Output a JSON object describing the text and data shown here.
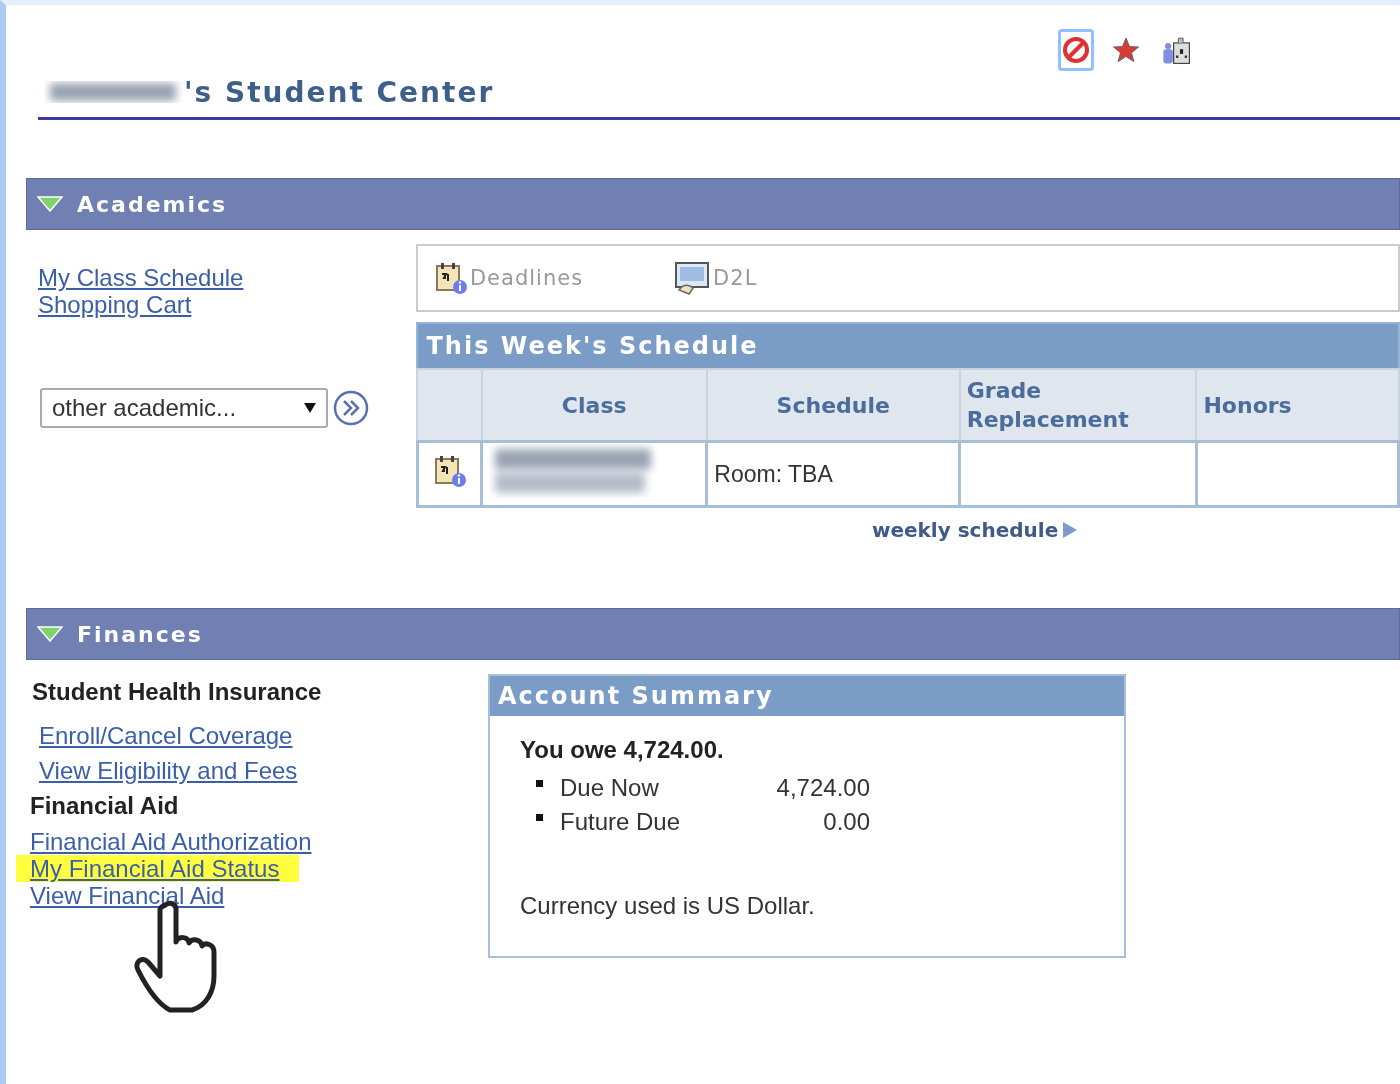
{
  "page_title": "'s Student Center",
  "header_icons": [
    {
      "kind": "no-entry",
      "selected": true
    },
    {
      "kind": "star",
      "selected": false
    },
    {
      "kind": "campus",
      "selected": false
    }
  ],
  "academics": {
    "title": "Academics",
    "expanded": true,
    "links": [
      "My Class Schedule",
      "Shopping Cart"
    ],
    "select": {
      "value": "other academic..."
    },
    "quick_links": [
      {
        "kind": "calendar",
        "label": "Deadlines"
      },
      {
        "kind": "monitor",
        "label": "D2L"
      }
    ],
    "schedule": {
      "title": "This Week's Schedule",
      "columns": [
        "Class",
        "Schedule",
        "Grade Replacement",
        "Honors"
      ],
      "rows": [
        {
          "schedule": "Room:  TBA",
          "grade_replacement": "",
          "honors": ""
        }
      ]
    },
    "weekly_link": "weekly schedule"
  },
  "finances": {
    "title": "Finances",
    "expanded": true,
    "groups": [
      {
        "heading": "Student Health Insurance",
        "indented": true,
        "links": [
          {
            "label": "Enroll/Cancel Coverage",
            "highlighted": false
          },
          {
            "label": "View Eligibility and Fees",
            "highlighted": false
          }
        ]
      },
      {
        "heading": "Financial Aid",
        "indented": false,
        "links": [
          {
            "label": "Financial Aid Authorization",
            "highlighted": false
          },
          {
            "label": "My Financial Aid Status",
            "highlighted": true
          },
          {
            "label": "View Financial Aid",
            "highlighted": false
          }
        ]
      }
    ],
    "account_summary": {
      "title": "Account Summary",
      "owe": "You owe 4,724.00.",
      "items": [
        {
          "label": "Due Now",
          "amount": "4,724.00"
        },
        {
          "label": "Future Due",
          "amount": "0.00"
        }
      ],
      "currency_note": "Currency used is US Dollar."
    }
  }
}
